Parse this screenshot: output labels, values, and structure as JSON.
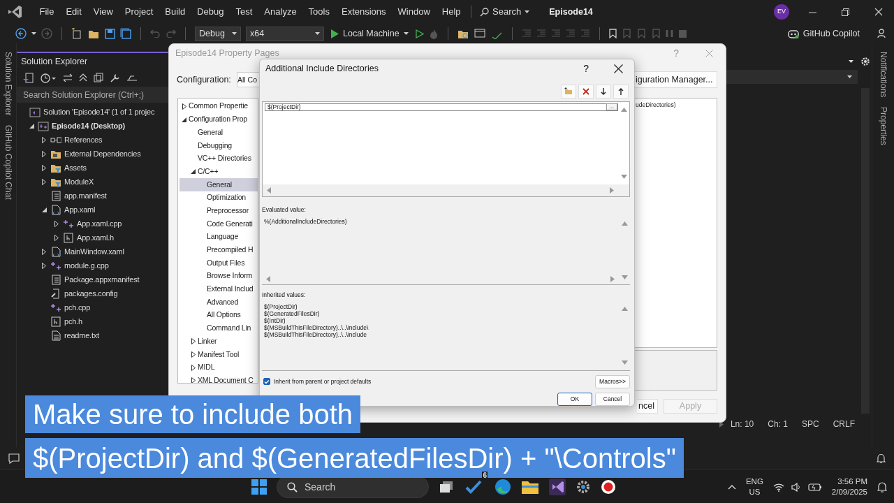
{
  "title_bar": {
    "menus": [
      "File",
      "Edit",
      "View",
      "Project",
      "Build",
      "Debug",
      "Test",
      "Analyze",
      "Tools",
      "Extensions",
      "Window",
      "Help"
    ],
    "search": "Search",
    "title": "Episode14",
    "avatar": "EV"
  },
  "toolbar": {
    "configuration": "Debug",
    "platform": "x64",
    "run_target": "Local Machine",
    "copilot": "GitHub Copilot"
  },
  "left_tabs": [
    "Solution Explorer",
    "GitHub Copilot Chat"
  ],
  "solution_explorer": {
    "title": "Solution Explorer",
    "search": {
      "placeholder": "Search Solution Explorer (Ctrl+;)"
    },
    "items": [
      {
        "label": "Solution 'Episode14' (1 of 1 projec",
        "kind": "solution",
        "children": [
          {
            "label": "Episode14 (Desktop)",
            "kind": "project",
            "expanded": true,
            "children": [
              {
                "label": "References",
                "kind": "references",
                "expanded": false
              },
              {
                "label": "External Dependencies",
                "kind": "external",
                "expanded": false
              },
              {
                "label": "Assets",
                "kind": "filter",
                "expanded": false
              },
              {
                "label": "ModuleX",
                "kind": "filter",
                "expanded": false
              },
              {
                "label": "app.manifest",
                "kind": "manifest"
              },
              {
                "label": "App.xaml",
                "kind": "xaml",
                "expanded": true,
                "children": [
                  {
                    "label": "App.xaml.cpp",
                    "kind": "cpp",
                    "expanded": false
                  },
                  {
                    "label": "App.xaml.h",
                    "kind": "header",
                    "expanded": false
                  }
                ]
              },
              {
                "label": "MainWindow.xaml",
                "kind": "xaml",
                "expanded": false
              },
              {
                "label": "module.g.cpp",
                "kind": "cpp",
                "expanded": false
              },
              {
                "label": "Package.appxmanifest",
                "kind": "manifest"
              },
              {
                "label": "packages.config",
                "kind": "config"
              },
              {
                "label": "pch.cpp",
                "kind": "cpp"
              },
              {
                "label": "pch.h",
                "kind": "header"
              },
              {
                "label": "readme.txt",
                "kind": "text"
              }
            ]
          }
        ]
      }
    ]
  },
  "right_tabs": [
    "Notifications",
    "Properties"
  ],
  "status_bar": {
    "line": "Ln: 10",
    "column": "Ch: 1",
    "whitespace": "SPC",
    "line_endings": "CRLF"
  },
  "property_pages": {
    "title": "Episode14 Property Pages",
    "help": "?",
    "configuration_label": "Configuration:",
    "configuration_value": "All Co",
    "configuration_manager": "iguration Manager...",
    "tree": [
      {
        "label": "Common Propertie",
        "expanded": false,
        "selected": false
      },
      {
        "label": "Configuration Prop",
        "expanded": true,
        "selected": false,
        "children": [
          {
            "label": "General",
            "selected": false
          },
          {
            "label": "Debugging",
            "selected": false
          },
          {
            "label": "VC++ Directories",
            "selected": false
          },
          {
            "label": "C/C++",
            "expanded": true,
            "selected": false,
            "children": [
              {
                "label": "General",
                "selected": true
              },
              {
                "label": "Optimization",
                "selected": false
              },
              {
                "label": "Preprocessor",
                "selected": false
              },
              {
                "label": "Code Generati",
                "selected": false
              },
              {
                "label": "Language",
                "selected": false
              },
              {
                "label": "Precompiled H",
                "selected": false
              },
              {
                "label": "Output Files",
                "selected": false
              },
              {
                "label": "Browse Inform",
                "selected": false
              },
              {
                "label": "External Includ",
                "selected": false
              },
              {
                "label": "Advanced",
                "selected": false
              },
              {
                "label": "All Options",
                "selected": false
              },
              {
                "label": "Command Lin",
                "selected": false
              }
            ]
          },
          {
            "label": "Linker",
            "expanded": false,
            "selected": false
          },
          {
            "label": "Manifest Tool",
            "expanded": false,
            "selected": false
          },
          {
            "label": "MIDL",
            "expanded": false,
            "selected": false
          },
          {
            "label": "XML Document C",
            "expanded": false,
            "selected": false
          }
        ]
      }
    ],
    "grid_value": "udeDirectories)",
    "cancel": "ncel",
    "apply": {
      "label": "Apply",
      "disabled": true
    }
  },
  "dialog": {
    "title": "Additional Include Directories",
    "help": "?",
    "entries": [
      {
        "text": "$(ProjectDir)"
      }
    ],
    "browse": "...",
    "evaluated_label": "Evaluated value:",
    "evaluated_value": "%(AdditionalIncludeDirectories)",
    "inherited_label": "Inherited values:",
    "inherited_values": [
      "$(ProjectDir)",
      "$(GeneratedFilesDir)",
      "$(IntDir)",
      "$(MSBuildThisFileDirectory)..\\..\\include\\",
      "$(MSBuildThisFileDirectory)..\\..\\include"
    ],
    "inherit": {
      "label": "Inherit from parent or project defaults",
      "checked": true
    },
    "macros": "Macros>>",
    "ok": "OK",
    "cancel": "Cancel"
  },
  "caption": [
    "Make sure to include both",
    "$(ProjectDir) and $(GeneratedFilesDir) + \"\\Controls\""
  ],
  "taskbar": {
    "search": "Search",
    "badge": "6",
    "language": "ENG",
    "region": "US",
    "time": "3:56 PM",
    "date": "2/09/2025"
  }
}
